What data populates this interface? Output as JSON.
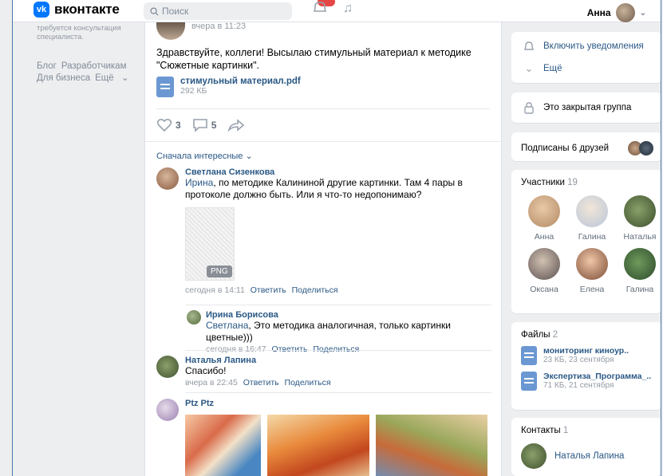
{
  "header": {
    "logo_text": "вконтакте",
    "logo_mark": "vk",
    "search_placeholder": "Поиск",
    "user_name": "Анна"
  },
  "sidebar": {
    "note": "требуется консультация специалиста.",
    "links": [
      "Блог",
      "Разработчикам",
      "Для бизнеса",
      "Ещё"
    ]
  },
  "post": {
    "time": "вчера в 11:23",
    "text": "Здравствуйте, коллеги! Высылаю стимульный материал к методике \"Сюжетные картинки\".",
    "doc_name": "стимульный материал.pdf",
    "doc_size": "292 КБ",
    "likes": "3",
    "comments": "5",
    "sort_label": "Сначала интересные"
  },
  "comments": [
    {
      "name": "Светлана Сизенкова",
      "mention": "Ирина",
      "text": ", по методике Калининой другие картинки. Там 4 пары в протоколе должно быть. Или я что-то недопонимаю?",
      "attachment_badge": "PNG",
      "time": "сегодня в 14:11",
      "reply": "Ответить",
      "share": "Поделиться"
    },
    {
      "name": "Ирина Борисова",
      "mention": "Светлана",
      "text": ", Это методика аналогичная, только картинки цветные)))",
      "time": "сегодня в 16:47",
      "reply": "Ответить",
      "share": "Поделиться"
    },
    {
      "name": "Наталья Лапина",
      "text": "Спасибо!",
      "time": "вчера в 22:45",
      "reply": "Ответить",
      "share": "Поделиться"
    },
    {
      "name": "Ptz Ptz"
    }
  ],
  "right": {
    "notify": "Включить уведомления",
    "more": "Ещё",
    "closed_group": "Это закрытая группа",
    "friends": "Подписаны 6 друзей",
    "members_title": "Участники",
    "members_count": "19",
    "members": [
      "Анна",
      "Галина",
      "Наталья",
      "Оксана",
      "Елена",
      "Галина"
    ],
    "files_title": "Файлы",
    "files_count": "2",
    "files": [
      {
        "name": "мониторинг киноур..",
        "meta": "23 КБ, 23 сентября"
      },
      {
        "name": "Экспертиза_Программа_..",
        "meta": "71 КБ, 21 сентября"
      }
    ],
    "contacts_title": "Контакты",
    "contacts_count": "1",
    "contact_name": "Наталья Лапина"
  },
  "colors": {
    "accent": "#2a5885",
    "brand": "#0077ff",
    "background": "#edeef0",
    "badge": "#e64646"
  }
}
